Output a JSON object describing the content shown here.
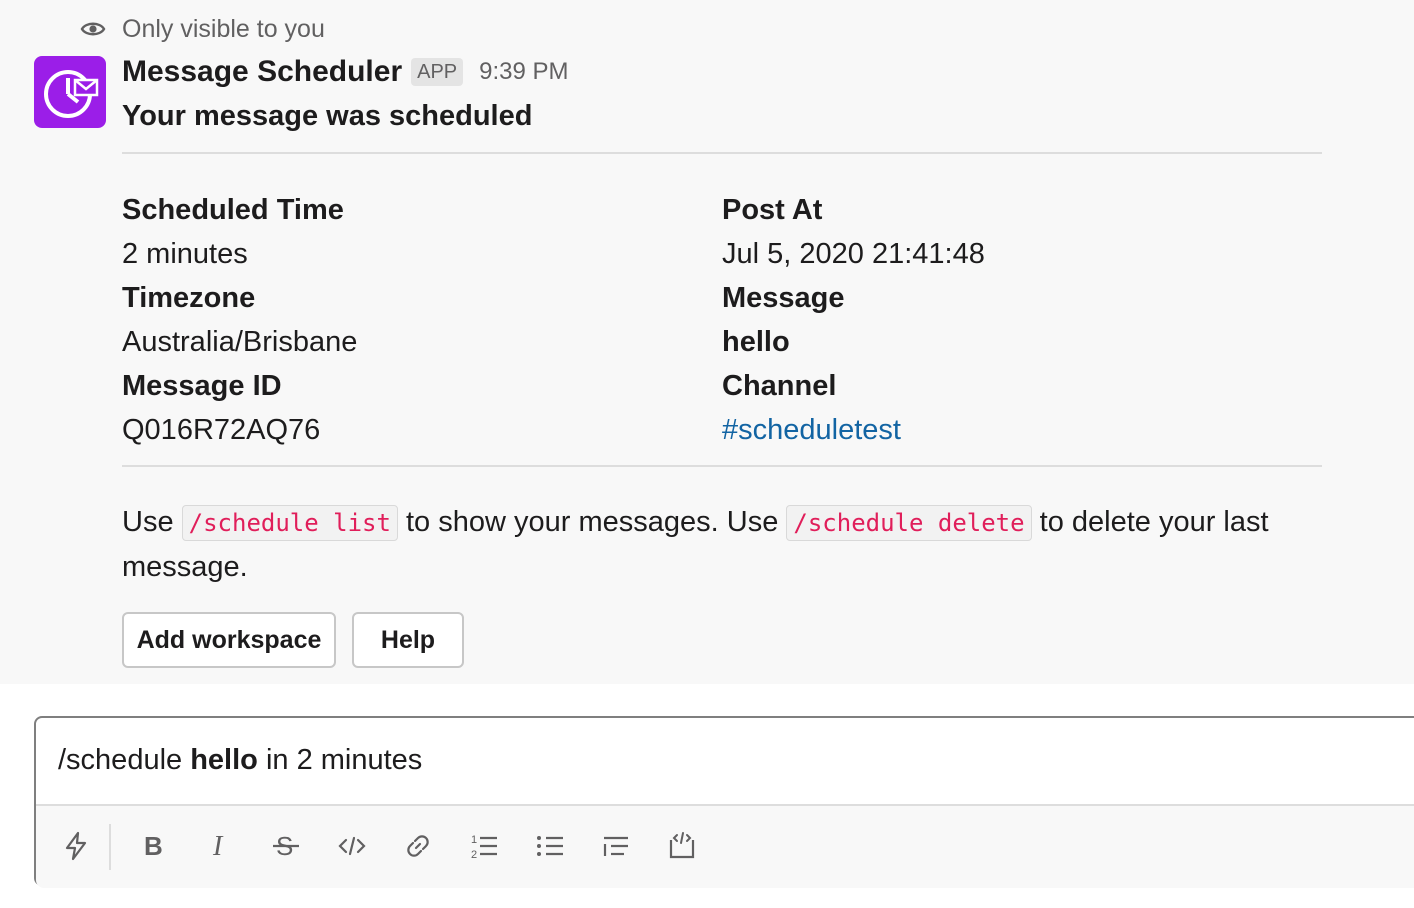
{
  "visibility_note": "Only visible to you",
  "message": {
    "sender": "Message Scheduler",
    "badge": "APP",
    "time": "9:39 PM",
    "title": "Your message was scheduled",
    "fields_left": [
      {
        "label": "Scheduled Time",
        "value": "2 minutes"
      },
      {
        "label": "Timezone",
        "value": "Australia/Brisbane"
      },
      {
        "label": "Message ID",
        "value": "Q016R72AQ76"
      }
    ],
    "fields_right": [
      {
        "label": "Post At",
        "value": "Jul 5, 2020 21:41:48"
      },
      {
        "label": "Message",
        "value": "hello"
      },
      {
        "label": "Channel",
        "value": "#scheduletest"
      }
    ],
    "help": {
      "part1": "Use",
      "code1": "/schedule list",
      "part2": "to show your messages. Use",
      "code2": "/schedule delete",
      "part3": "to delete your last message."
    },
    "buttons": {
      "add_workspace": "Add workspace",
      "help": "Help"
    }
  },
  "composer": {
    "prefix": "/schedule",
    "bold": "hello",
    "suffix": "in 2 minutes"
  },
  "colors": {
    "avatar_bg": "#9b1ee8",
    "link": "#1264a3",
    "code_text": "#e01e5a",
    "message_bg": "#f8f8f8"
  },
  "toolbar_icons": [
    "shortcuts-icon",
    "bold-icon",
    "italic-icon",
    "strikethrough-icon",
    "code-icon",
    "link-icon",
    "ordered-list-icon",
    "bulleted-list-icon",
    "blockquote-icon",
    "code-block-icon"
  ]
}
